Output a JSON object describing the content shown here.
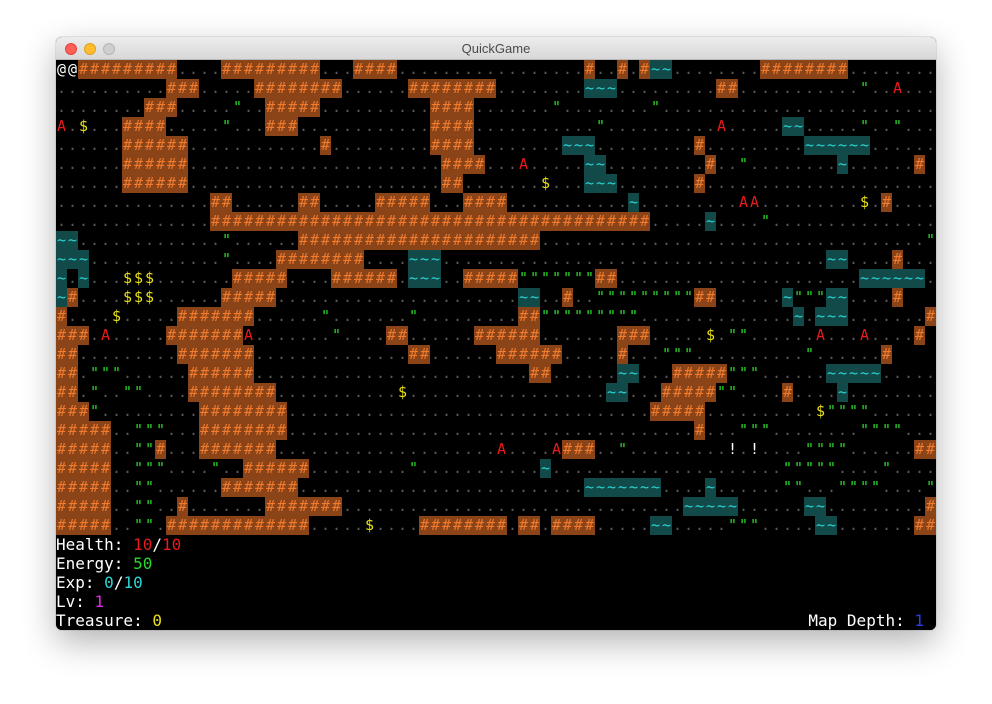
{
  "window": {
    "title": "QuickGame"
  },
  "map": {
    "glyphs": {
      "wall": "#",
      "floor": ".",
      "water": "~",
      "grass": "\"",
      "gold": "$",
      "enemy": "A",
      "player": "@",
      "item": "!"
    },
    "colors": {
      "wall_bg": "#8a4418",
      "wall_fg": "#f07a2e",
      "floor": "#5a5a5a",
      "water_bg": "#124a4a",
      "water_fg": "#2ad5d5",
      "grass": "#2bd92b",
      "gold": "#e8e014",
      "enemy": "#e8191a",
      "player": "#ffffff",
      "item": "#ffffff"
    },
    "rows": [
      "@.#########....#########...####.................#..#.#~~........########..........#",
      "..........###.....########......########........~~~.........##...........\"......A#",
      "........###.....\"..#####..........####.......\"........\"..........................",
      "A.$...####.....\"...###............####...........\"..........A.....~~.....\"..\"....",
      "......######............#.........####........~~~.........#.........~~~~~~.......#",
      "......######.......................####...A.....~~.........#..\"........~......#",
      "......######.......................##.......$...~~~.......#.......................#",
      "..............##......##.....#####...####...........~..........A.........$.#.....\"#",
      "..............########################################.....~....\"................##",
      "~~.............\"......######################...................................\"#",
      "~~~............\"....########....~~~...................................~~....#...#",
      "~.~...$$$.......#####....######.~~~..#####\"\"\"\"\"\"\"##......................~~~~~~...#",
      "~#....$$$......#####......................~~..#..\"\"\"\"\"\"\"\"\"##......~\"\"\"~~....#",
      "#....$.....#######......\".......\".........##\"\"\"\"\"\"\"\"\"..............~.~~~.......#",
      "###.A.....#######A.......\"....##......######.......###.....$.\"\"......A........#",
      "##.........#######..............##......######.....#...\"\"\"..........\"......#",
      "##.\"\"\"......######.........................##......~~...#####\"\"\"......~~~~~.....",
      "##.\"..\"\"....########...........$..................~~...#####\"\"....#....~.........",
      "###\".........########.................................#####..........$\"\"\"\"......##",
      "#####..\"\"\"...########.....................................#...\"\"\"........\"\"\"\".....##",
      "#####..\"\"#...#######....................A.....###..\"...........!....\"\"\"\"......#####",
      "#####..\"\"\"....\"..######.........\"...........~.....................\"\"\"\"\"....\".....######",
      "#####..\"\"......#######..........................~~~~~~~....~......\"\"...\"\"\"\"....\"######",
      "#####..\"\"..#.......#######...............................~~~~~......~~.........#######",
      "#####..\"\".#############.....$....########.##.####.....~~.....\"\"\".....~~.......##...####"
    ],
    "entities": [
      {
        "type": "player",
        "label": "@",
        "col": 1,
        "row": 0
      },
      {
        "type": "enemy",
        "label": "A",
        "col": 76,
        "row": 1
      },
      {
        "type": "enemy",
        "label": "A",
        "col": 0,
        "row": 3
      },
      {
        "type": "enemy",
        "label": "A",
        "col": 60,
        "row": 3
      },
      {
        "type": "enemy",
        "label": "A",
        "col": 42,
        "row": 5
      },
      {
        "type": "enemy",
        "label": "A",
        "col": 62,
        "row": 7
      },
      {
        "type": "enemy",
        "label": "A",
        "col": 4,
        "row": 14
      },
      {
        "type": "enemy",
        "label": "A",
        "col": 17,
        "row": 14
      },
      {
        "type": "enemy",
        "label": "A",
        "col": 73,
        "row": 14
      },
      {
        "type": "enemy",
        "label": "A",
        "col": 45,
        "row": 20
      },
      {
        "type": "item",
        "label": "!",
        "col": 61,
        "row": 20
      }
    ]
  },
  "hud": {
    "health_label": "Health: ",
    "health_current": "10",
    "health_sep": "/",
    "health_max": "10",
    "energy_label": "Energy: ",
    "energy_value": "50",
    "exp_label": "Exp: ",
    "exp_current": "0",
    "exp_sep": "/",
    "exp_max": "10",
    "level_label": "Lv: ",
    "level_value": "1",
    "treasure_label": "Treasure: ",
    "treasure_value": "0",
    "depth_label": "Map Depth: ",
    "depth_value": "1"
  }
}
